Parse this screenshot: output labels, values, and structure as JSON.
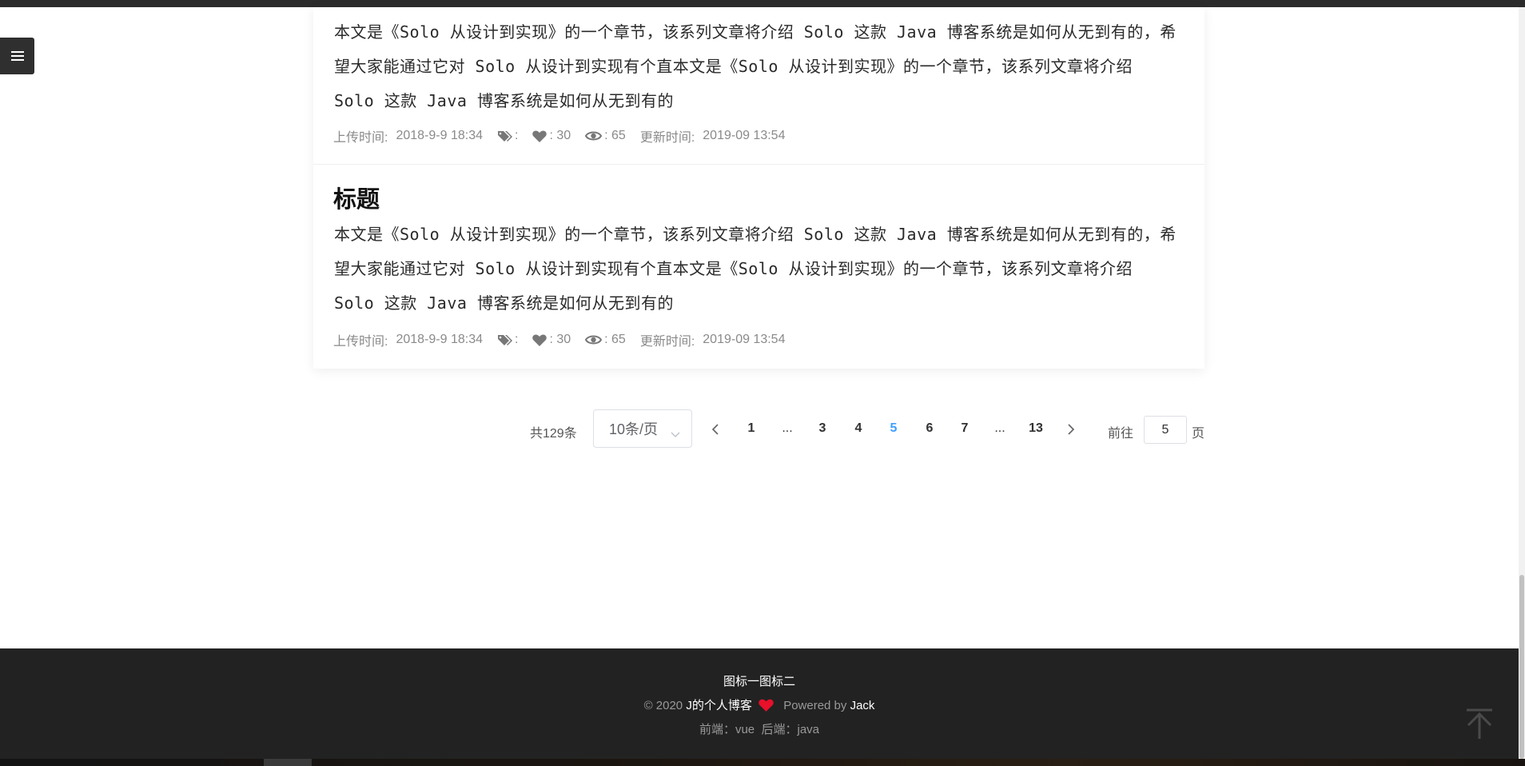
{
  "posts": [
    {
      "title": "",
      "excerpt": "本文是《Solo 从设计到实现》的一个章节，该系列文章将介绍 Solo 这款 Java 博客系统是如何从无到有的，希望大家能通过它对 Solo 从设计到实现有个直本文是《Solo 从设计到实现》的一个章节，该系列文章将介绍 Solo 这款 Java 博客系统是如何从无到有的",
      "upload_label": "上传时间:",
      "upload_time": "2018-9-9 18:34",
      "tags_text": ":",
      "likes_text": ": 30",
      "views_text": ": 65",
      "update_label": "更新时间:",
      "update_time": "2019-09 13:54"
    },
    {
      "title": "标题",
      "excerpt": "本文是《Solo 从设计到实现》的一个章节，该系列文章将介绍 Solo 这款 Java 博客系统是如何从无到有的，希望大家能通过它对 Solo 从设计到实现有个直本文是《Solo 从设计到实现》的一个章节，该系列文章将介绍 Solo 这款 Java 博客系统是如何从无到有的",
      "upload_label": "上传时间:",
      "upload_time": "2018-9-9 18:34",
      "tags_text": ":",
      "likes_text": ": 30",
      "views_text": ": 65",
      "update_label": "更新时间:",
      "update_time": "2019-09 13:54"
    }
  ],
  "pagination": {
    "total": "共129条",
    "page_size": "10条/页",
    "pages": [
      "1",
      "...",
      "3",
      "4",
      "5",
      "6",
      "7",
      "...",
      "13"
    ],
    "current": "5",
    "goto_label": "前往",
    "goto_value": "5",
    "page_suffix": "页"
  },
  "footer": {
    "line1": "图标一图标二",
    "copyright": "© 2020",
    "blog_name": "J的个人博客",
    "powered_by": "Powered by",
    "author": "Jack",
    "tech_line": "前端：vue  后端：java"
  },
  "icons": {
    "menu": "menu-icon",
    "tag": "tag-icon",
    "like": "heart-icon",
    "views": "eye-icon",
    "back_to_top": "arrow-up-icon"
  },
  "colors": {
    "accent": "#409eff",
    "heart": "#e8102a",
    "footer_bg": "#222222"
  }
}
